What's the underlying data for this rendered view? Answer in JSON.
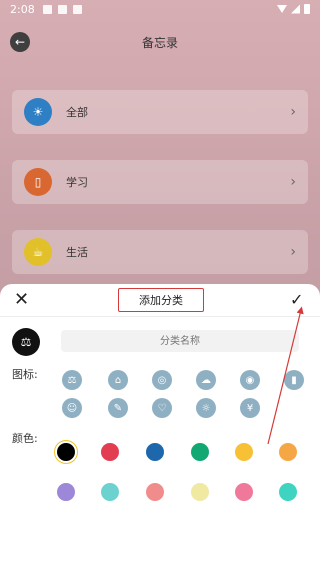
{
  "status": {
    "time": "2:08"
  },
  "header": {
    "title": "备忘录"
  },
  "categories": [
    {
      "label": "全部",
      "color": "#2e7fc3",
      "icon": "lightbulb-icon"
    },
    {
      "label": "学习",
      "color": "#d86732",
      "icon": "book-icon"
    },
    {
      "label": "生活",
      "color": "#e1c02a",
      "icon": "coffee-icon"
    }
  ],
  "sheet": {
    "title": "添加分类",
    "input_placeholder": "分类名称",
    "icons_label": "图标:",
    "colors_label": "颜色:",
    "icon_options": [
      "scale-icon",
      "graduation-cap-icon",
      "compass-icon",
      "cloud-icon",
      "teapot-icon",
      "phone-icon",
      "person-icon",
      "pencil-icon",
      "heart-icon",
      "lightbulb-icon",
      "money-icon"
    ],
    "colors_row1": [
      "#000000",
      "#e23d50",
      "#1d67ad",
      "#12a873",
      "#f7c035",
      "#f5a645"
    ],
    "colors_row2": [
      "#9c87d8",
      "#6bd2cf",
      "#f08c8c",
      "#f0e9a2",
      "#f0789b",
      "#3fd3c1"
    ]
  }
}
